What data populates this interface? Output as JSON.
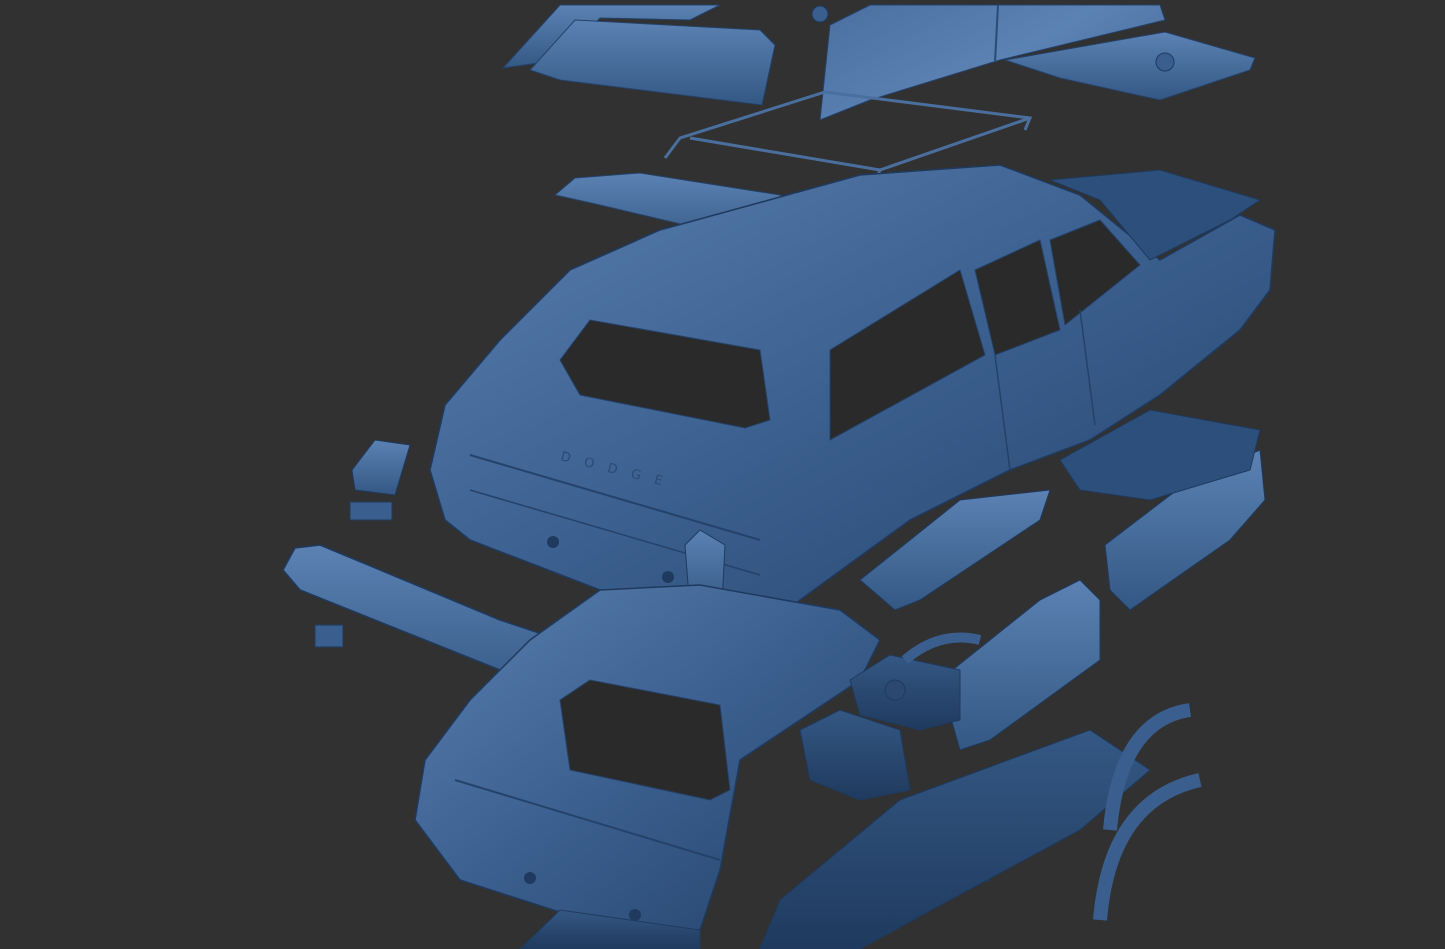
{
  "viewport": {
    "background_color": "#313131",
    "model_color": "#3a5f8f",
    "model_highlight": "#5b82b3",
    "model_shadow": "#1f3a5e"
  },
  "scene": {
    "parts": [
      "windshield-glass-panel",
      "side-window-panel",
      "roof-panel",
      "hood-panel",
      "roof-rack",
      "rear-spoiler",
      "wagon-body-upper",
      "front-fascia",
      "rear-bumper",
      "tail-light-left",
      "tail-light-right",
      "wagon-body-lower",
      "door-panel",
      "interior-tub",
      "dashboard",
      "seats",
      "chassis-frame",
      "wheel-well-flares"
    ],
    "body_lettering": "DODGE"
  }
}
